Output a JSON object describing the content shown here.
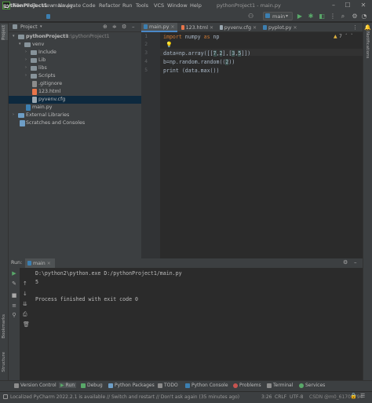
{
  "menu": {
    "items": [
      "File",
      "Edit",
      "View",
      "Navigate",
      "Code",
      "Refactor",
      "Run",
      "Tools",
      "VCS",
      "Window",
      "Help"
    ],
    "window_title": "pythonProject1 - main.py"
  },
  "nav": {
    "project": "pythonProject1",
    "file": "main.py",
    "run_config": "main"
  },
  "project_panel": {
    "title": "Project",
    "tree": [
      {
        "label": "pythonProject1",
        "suffix": "D:\\pythonProject1",
        "kind": "folder",
        "depth": 0,
        "expanded": true
      },
      {
        "label": "venv",
        "kind": "folder",
        "depth": 1,
        "expanded": true
      },
      {
        "label": "Include",
        "kind": "folder",
        "depth": 2,
        "expanded": false
      },
      {
        "label": "Lib",
        "kind": "folder",
        "depth": 2,
        "expanded": false
      },
      {
        "label": "libs",
        "kind": "folder",
        "depth": 2,
        "expanded": false
      },
      {
        "label": "Scripts",
        "kind": "folder",
        "depth": 2,
        "expanded": false
      },
      {
        "label": ".gitignore",
        "kind": "file",
        "depth": 2
      },
      {
        "label": "123.html",
        "kind": "html",
        "depth": 2
      },
      {
        "label": "pyvenv.cfg",
        "kind": "cfg",
        "depth": 2,
        "selected": true
      },
      {
        "label": "main.py",
        "kind": "py",
        "depth": 1
      },
      {
        "label": "External Libraries",
        "kind": "lib",
        "depth": 0,
        "expanded": false
      },
      {
        "label": "Scratches and Consoles",
        "kind": "scratch",
        "depth": 0
      }
    ]
  },
  "editor": {
    "tabs": [
      "main.py",
      "123.html",
      "pyvenv.cfg",
      "pyplot.py"
    ],
    "active_tab": "main.py",
    "warnings": "7",
    "lines": [
      "import numpy as np",
      "",
      "data=np.array([[7,2],[3,5]])",
      "b=np.random.random((2))",
      "print (data.max())"
    ],
    "line_numbers": [
      "1",
      "2",
      "3",
      "4",
      "5"
    ]
  },
  "run_panel": {
    "label": "Run:",
    "tab": "main",
    "output": [
      "D:\\python2\\python.exe D:/pythonProject1/main.py",
      "5",
      "",
      "Process finished with exit code 0"
    ]
  },
  "bottom_tabs": [
    "Version Control",
    "Run",
    "Debug",
    "Python Packages",
    "TODO",
    "Python Console",
    "Problems",
    "Terminal",
    "Services"
  ],
  "status": {
    "message": "Localized PyCharm 2022.2.1 is available // Switch and restart // Don't ask again (35 minutes ago)",
    "position": "3:26",
    "line_sep": "CRLF",
    "encoding": "UTF-8",
    "watermark": "CSDN @m0_61709794"
  },
  "side_labels": {
    "project": "Project",
    "bookmarks": "Bookmarks",
    "structure": "Structure",
    "notifications": "Notifications"
  }
}
